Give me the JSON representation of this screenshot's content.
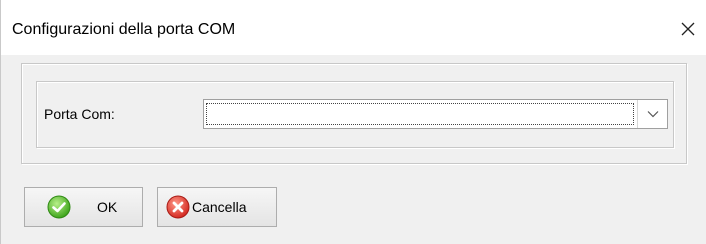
{
  "window": {
    "title": "Configurazioni della porta COM",
    "close_icon": "close-icon"
  },
  "form": {
    "port_label": "Porta Com:",
    "port_value": "",
    "dropdown_icon": "chevron-down-icon"
  },
  "buttons": {
    "ok_label": "OK",
    "ok_icon": "check-circle-icon",
    "ok_icon_color": "#5cc42e",
    "cancel_label": "Cancella",
    "cancel_icon": "x-circle-icon",
    "cancel_icon_color": "#e8403a"
  }
}
